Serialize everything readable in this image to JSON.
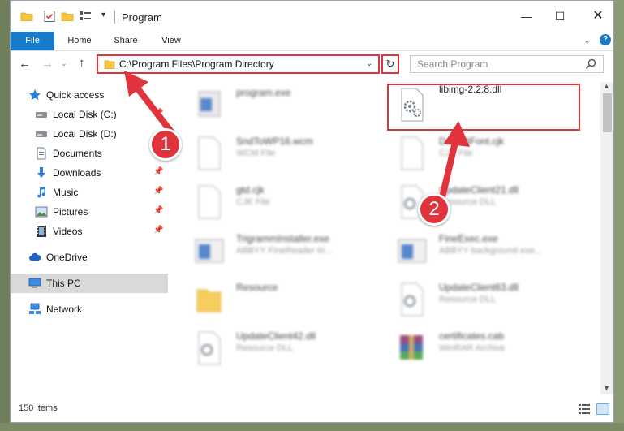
{
  "window": {
    "title": "Program"
  },
  "ribbon": {
    "tabs": [
      "File",
      "Home",
      "Share",
      "View"
    ],
    "help": "?"
  },
  "address": {
    "path": "C:\\Program Files\\Program Directory"
  },
  "search": {
    "placeholder": "Search Program"
  },
  "sidebar": {
    "items": [
      {
        "label": "Quick access",
        "icon": "star-icon",
        "pinned": false
      },
      {
        "label": "Local Disk (C:)",
        "icon": "drive-icon",
        "pinned": true
      },
      {
        "label": "Local Disk (D:)",
        "icon": "drive-icon",
        "pinned": false
      },
      {
        "label": "Documents",
        "icon": "documents-icon",
        "pinned": true
      },
      {
        "label": "Downloads",
        "icon": "download-arrow-icon",
        "pinned": true
      },
      {
        "label": "Music",
        "icon": "music-note-icon",
        "pinned": true
      },
      {
        "label": "Pictures",
        "icon": "pictures-icon",
        "pinned": true
      },
      {
        "label": "Videos",
        "icon": "film-icon",
        "pinned": true
      },
      {
        "label": "OneDrive",
        "icon": "cloud-icon",
        "pinned": false
      },
      {
        "label": "This PC",
        "icon": "computer-icon",
        "pinned": false,
        "selected": true
      },
      {
        "label": "Network",
        "icon": "network-icon",
        "pinned": false
      }
    ]
  },
  "files": [
    {
      "name": "program.exe",
      "type": "",
      "icon": "exe-icon",
      "blurred": true
    },
    {
      "name": "libimg-2.2.8.dll",
      "type": "",
      "icon": "dll-gear-icon",
      "blurred": false
    },
    {
      "name": "SndToWP16.wcm",
      "type": "WCM File",
      "icon": "blank-file-icon",
      "blurred": true
    },
    {
      "name": "DefaultFont.cjk",
      "type": "CJK File",
      "icon": "blank-file-icon",
      "blurred": true
    },
    {
      "name": "gtd.cjk",
      "type": "CJK File",
      "icon": "blank-file-icon",
      "blurred": true
    },
    {
      "name": "UpdateClient21.dll",
      "type": "Resource DLL",
      "icon": "dll-gear-icon",
      "blurred": true
    },
    {
      "name": "TrigrammInstaller.exe",
      "type": "ABBYY FineReader tri...",
      "icon": "app-window-icon",
      "blurred": true
    },
    {
      "name": "FineExec.exe",
      "type": "ABBYY background exe...",
      "icon": "app-window-icon",
      "blurred": true
    },
    {
      "name": "Resource",
      "type": "",
      "icon": "folder-icon",
      "blurred": true
    },
    {
      "name": "UpdateClient63.dll",
      "type": "Resource DLL",
      "icon": "dll-gear-icon",
      "blurred": true
    },
    {
      "name": "UpdateClient42.dll",
      "type": "Resource DLL",
      "icon": "dll-gear-icon",
      "blurred": true
    },
    {
      "name": "certificates.cab",
      "type": "WinRAR Archive",
      "icon": "winrar-icon",
      "blurred": true
    }
  ],
  "callouts": [
    "1",
    "2"
  ],
  "status": {
    "items_count": "150 items"
  },
  "colors": {
    "accent": "#1979ca",
    "callout": "#e0333c"
  }
}
